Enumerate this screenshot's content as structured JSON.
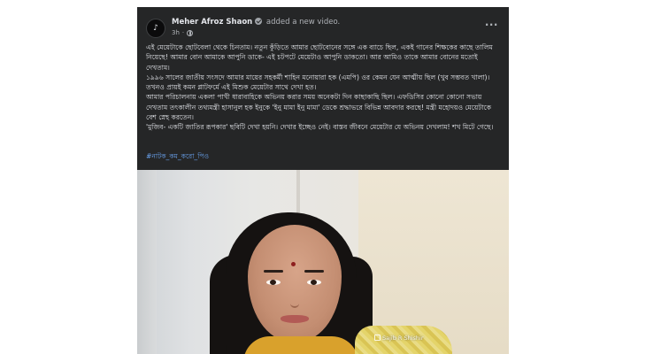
{
  "post": {
    "author": "Meher Afroz Shaon",
    "action": "added a new video.",
    "time": "3h",
    "avatar_glyph": "♪",
    "more_label": "···",
    "body": [
      "এই মেয়েটাকে ছোটবেলা থেকে চিনতাম। নতুন কুঁড়িতে আমার ছোটবোনের সঙ্গে এক ব্যাচে ছিল, একই গানের শিক্ষকের কাছে তালিম নিয়েছে! আমার বোন আমাকে আপুনি ডাকে- এই চটপটে মেয়েটাও আপুনি ডাকতো। আর আমিও তাকে আমার বোনের মতোই দেখতাম।",
      "১৯৯৬ সালের জাতীয় সংসদে আমার মায়ের সহকর্মী শাহিন মনোয়ারা হক (এমপি) ওর কেমন যেন আত্মীয় ছিল (খুব সম্ভবত খালা)। তখনও প্রায়ই কমন প্লাটফর্মে এই মিশুক মেয়েটার সাথে দেখা হত।",
      "আমার পরিচালনায় একলা পাখী ধারাবাহিকে অভিনয় করার সময় অনেকটা দিন কাছাকাছি ছিল। এফডিসির কোনো কোনো সভায় দেখতাম তৎকালীন তথ্যমন্ত্রী হাসানুল হক ইনুকে 'ইনু মামা ইনু মামা' ডেকে শ্রদ্ধাভরে বিভিন্ন আবদার করছে! মন্ত্রী মহোদয়ও মেয়েটাকে বেশ স্নেহ করতেন।",
      "'মুজিব- একটি জাতির রূপকার' ছবিটি দেখা হয়নি। দেখার ইচ্ছেও নেই। বাস্তব জীবনে মেয়েটার যে অভিনয় দেখলাম! শখ মিটে গেছে।"
    ],
    "hashtag": "#নাটক_কম_করো_পিও"
  },
  "video": {
    "watermark": "Sajib R Shishir"
  },
  "colors": {
    "post_background": "#252627",
    "text_primary": "#e4e6eb",
    "text_secondary": "#b0b3b8",
    "hashtag": "#6aa3f0"
  },
  "icons": {
    "verified": "verified-badge-icon",
    "audience": "globe-icon",
    "more": "more-options-icon"
  }
}
